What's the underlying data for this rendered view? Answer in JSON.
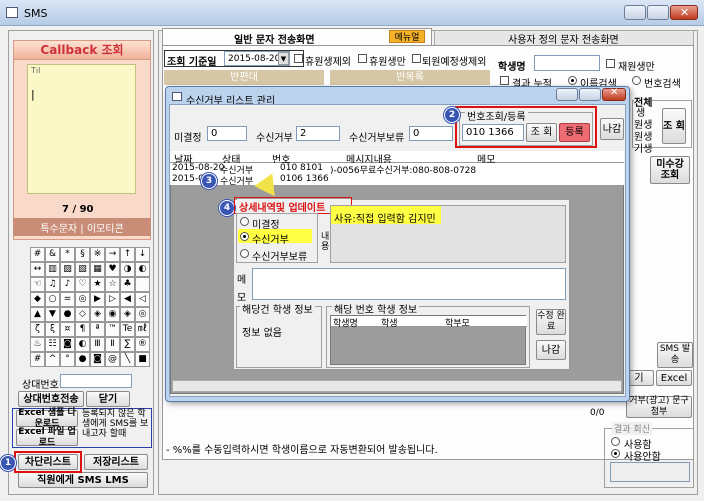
{
  "window": {
    "title": "SMS"
  },
  "callback": {
    "title": "Callback 조회",
    "signal": "Tıl",
    "cursor": "|",
    "counter": "7 / 90",
    "special_tabs": "특수문자 | 이모티콘"
  },
  "symbols": [
    "#",
    "&",
    "*",
    "§",
    "※",
    "→",
    "↑",
    "↓",
    "↔",
    "▥",
    "▨",
    "▧",
    "▦",
    "♥",
    "◑",
    "◐",
    "☜",
    "♫",
    "♪",
    "♡",
    "★",
    "☆",
    "♣",
    "",
    "◆",
    "○",
    "=",
    "◎",
    "▶",
    "▷",
    "◀",
    "◁",
    "▲",
    "▼",
    "●",
    "◇",
    "◈",
    "◉",
    "◈",
    "◎",
    "ζ",
    "ξ",
    "¤",
    "¶",
    "ª",
    "™",
    "Te",
    "㎖",
    "♨",
    "☷",
    "◙",
    "◐",
    "Ⅲ",
    "Ⅱ",
    "∑",
    "®",
    "#",
    "^",
    "°",
    "●",
    "◙",
    "@",
    "╲",
    "■"
  ],
  "left": {
    "peer_label": "상대번호",
    "peer_send": "상대번호전송",
    "close": "닫기",
    "excel_sample": "Excel 샘플 다운로드",
    "excel_upload": "Excel 파일 업로드",
    "unregistered_note": "등록되지 않은 학생에게 SMS를 보내고자 할때",
    "block_list": "차단리스트",
    "save_list": "저장리스트",
    "staff_sms": "직원에게 SMS LMS"
  },
  "main": {
    "tab_general": "일반 문자 전송화면",
    "tab_menu": "메뉴얼",
    "tab_user": "사용자 정의 문자 전송화면",
    "date_label": "조회 기준일",
    "date_value": "2015-08-20",
    "chk_leave": "휴원생제외",
    "chk_leaving": "휴원생만",
    "chk_exit_plan": "퇴원예정생제외",
    "class_header": "반편대",
    "repeat_header": "반목록",
    "student_name": "학생명",
    "chk_reenroll": "재원생만",
    "chk_result": "결과 누적",
    "radio_name": "이름검색",
    "radio_phone": "번호검색",
    "right_all": "전체",
    "right_side_rows": [
      "생",
      "원생",
      "원생",
      "기생"
    ],
    "lookup": "조 회",
    "unpaid": "미수강 조회",
    "sms_send": "SMS 발송",
    "excel": "Excel",
    "gi": "기",
    "reject_attach": "거부(광고) 문구첨부",
    "counter_small": "0/0",
    "footer_note": "- %%를 수동입력하시면 학생이름으로 자동변환되어 발송됩니다.",
    "reply_group": "결과 회신",
    "reply_use": "사용함",
    "reply_unused": "사용안함"
  },
  "dialog": {
    "title": "수신거부 리스트 관리",
    "unset_label": "미결정",
    "unset_value": "0",
    "reject_label": "수신거부",
    "reject_value": "2",
    "hold_label": "수신거부보류",
    "hold_value": "0",
    "lookup_group": "번호조회/등록",
    "phone_value": "010    1366",
    "search_btn": "조 회",
    "register_btn": "등록",
    "exit_btn": "나감",
    "columns": [
      "날짜",
      "상태",
      "번호",
      "메시지내용",
      "메모"
    ],
    "rows": [
      {
        "date": "2015-08-20",
        "status": "수신거부",
        "number": "010    8101",
        "message": ")-0056무료수신거부:080-808-0728",
        "memo": ""
      },
      {
        "date": "2015-0",
        "status": "수신거부",
        "number": "0106  1366",
        "message": "",
        "memo": ""
      }
    ],
    "detail": {
      "title": "상세내역및 업데이트",
      "radio_unset": "미결정",
      "radio_reject": "수신거부",
      "radio_hold": "수신거부보류",
      "reason": "사유:직접 입력함  김지민",
      "content_label": "내용",
      "memo_label": "메모",
      "student_group": "해당건 학생 정보",
      "student_none": "정보 없음",
      "number_group": "해당 번호 학생 정보",
      "col_student": "학생명",
      "col_school": "학생",
      "col_parent": "학부모",
      "edit_btn": "수정 완료",
      "exit_btn": "나감"
    }
  },
  "badges": [
    "1",
    "2",
    "3",
    "4"
  ],
  "colors": {
    "accent_red": "#d11111",
    "highlight_yellow": "#ffff44",
    "title_blue": "#3a6ea8",
    "badge_blue": "#3a56b3",
    "register_pink": "#ee6d75"
  }
}
